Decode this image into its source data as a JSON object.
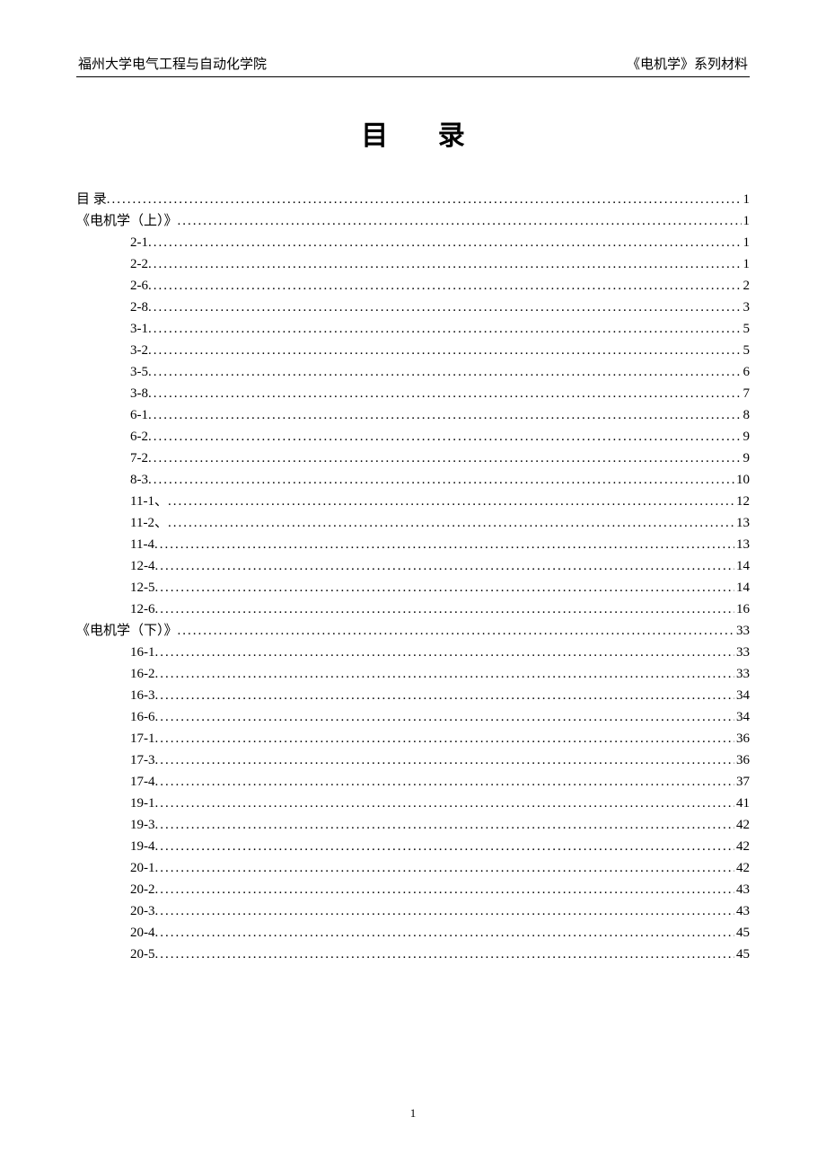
{
  "header": {
    "left": "福州大学电气工程与自动化学院",
    "right": "《电机学》系列材料"
  },
  "title": "目 录",
  "toc": [
    {
      "label": "目  录",
      "page": "1",
      "indent": 0
    },
    {
      "label": "《电机学（上）》",
      "page": "1",
      "indent": 0
    },
    {
      "label": "2-1",
      "page": "1",
      "indent": 1
    },
    {
      "label": "2-2",
      "page": "1",
      "indent": 1
    },
    {
      "label": "2-6",
      "page": "2",
      "indent": 1
    },
    {
      "label": "2-8",
      "page": "3",
      "indent": 1
    },
    {
      "label": "3-1",
      "page": "5",
      "indent": 1
    },
    {
      "label": "3-2",
      "page": "5",
      "indent": 1
    },
    {
      "label": "3-5",
      "page": "6",
      "indent": 1
    },
    {
      "label": "3-8",
      "page": "7",
      "indent": 1
    },
    {
      "label": "6-1",
      "page": "8",
      "indent": 1
    },
    {
      "label": "6-2",
      "page": "9",
      "indent": 1
    },
    {
      "label": "7-2",
      "page": "9",
      "indent": 1
    },
    {
      "label": "8-3",
      "page": "10",
      "indent": 1
    },
    {
      "label": "11-1、",
      "page": "12",
      "indent": 1
    },
    {
      "label": "11-2、",
      "page": "13",
      "indent": 1
    },
    {
      "label": "11-4",
      "page": "13",
      "indent": 1
    },
    {
      "label": "12-4",
      "page": "14",
      "indent": 1
    },
    {
      "label": "12-5",
      "page": "14",
      "indent": 1
    },
    {
      "label": "12-6",
      "page": "16",
      "indent": 1
    },
    {
      "label": "《电机学（下）》",
      "page": "33",
      "indent": 0
    },
    {
      "label": "16-1",
      "page": "33",
      "indent": 1
    },
    {
      "label": "16-2",
      "page": "33",
      "indent": 1
    },
    {
      "label": "16-3",
      "page": "34",
      "indent": 1
    },
    {
      "label": "16-6",
      "page": "34",
      "indent": 1
    },
    {
      "label": "17-1",
      "page": "36",
      "indent": 1
    },
    {
      "label": "17-3",
      "page": "36",
      "indent": 1
    },
    {
      "label": "17-4",
      "page": "37",
      "indent": 1
    },
    {
      "label": "19-1",
      "page": "41",
      "indent": 1
    },
    {
      "label": "19-3",
      "page": "42",
      "indent": 1
    },
    {
      "label": "19-4",
      "page": "42",
      "indent": 1
    },
    {
      "label": "20-1",
      "page": "42",
      "indent": 1
    },
    {
      "label": "20-2",
      "page": "43",
      "indent": 1
    },
    {
      "label": "20-3",
      "page": "43",
      "indent": 1
    },
    {
      "label": "20-4",
      "page": "45",
      "indent": 1
    },
    {
      "label": "20-5",
      "page": "45",
      "indent": 1
    }
  ],
  "footer": {
    "page_number": "1"
  }
}
